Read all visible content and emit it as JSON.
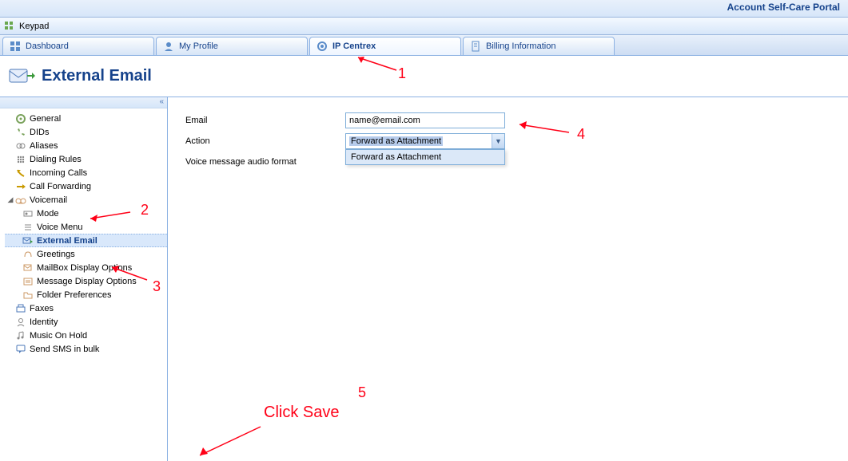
{
  "app_title": "Account Self-Care Portal",
  "toolbar": {
    "keypad": "Keypad"
  },
  "tabs": [
    {
      "label": "Dashboard"
    },
    {
      "label": "My Profile"
    },
    {
      "label": "IP Centrex"
    },
    {
      "label": "Billing Information"
    }
  ],
  "page": {
    "title": "External Email"
  },
  "collapse_glyph": "«",
  "tree": {
    "general": "General",
    "dids": "DIDs",
    "aliases": "Aliases",
    "dialing_rules": "Dialing Rules",
    "incoming_calls": "Incoming Calls",
    "call_forwarding": "Call Forwarding",
    "voicemail": "Voicemail",
    "mode": "Mode",
    "voice_menu": "Voice Menu",
    "external_email": "External Email",
    "greetings": "Greetings",
    "mailbox_display_options": "MailBox Display Options",
    "message_display_options": "Message Display Options",
    "folder_preferences": "Folder Preferences",
    "faxes": "Faxes",
    "identity": "Identity",
    "music_on_hold": "Music On Hold",
    "send_sms_in_bulk": "Send SMS in bulk"
  },
  "form": {
    "email_label": "Email",
    "email_value": "name@email.com",
    "action_label": "Action",
    "action_value": "Forward as Attachment",
    "action_option0": "Forward as Attachment",
    "audio_label": "Voice message audio format"
  },
  "annotations": {
    "n1": "1",
    "n2": "2",
    "n3": "3",
    "n4": "4",
    "n5": "5",
    "save": "Click Save"
  }
}
